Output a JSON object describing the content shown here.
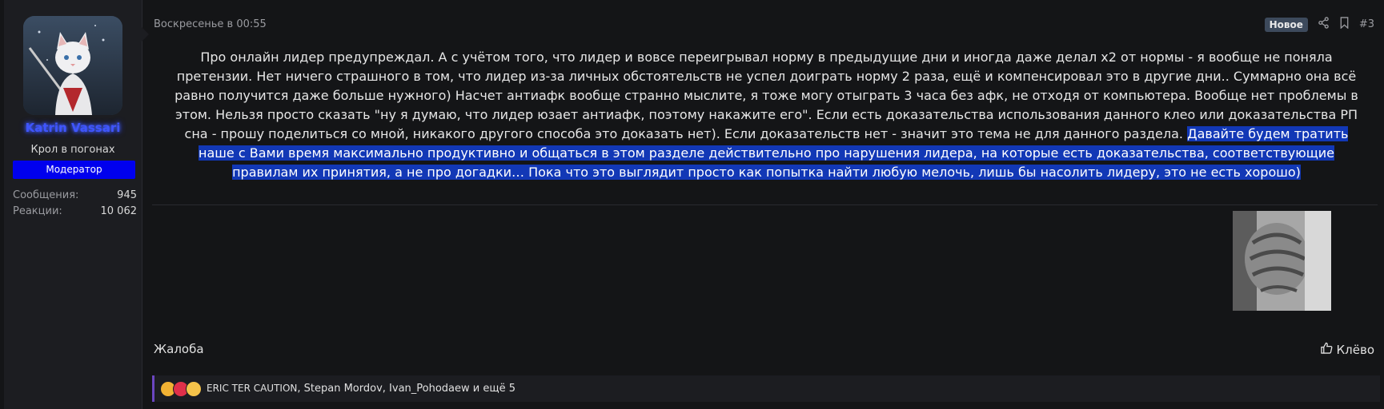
{
  "user": {
    "name": "Katrin Vassari",
    "title": "Крол в погонах",
    "role": "Модератор",
    "stats": [
      {
        "label": "Сообщения:",
        "value": "945"
      },
      {
        "label": "Реакции:",
        "value": "10 062"
      }
    ]
  },
  "post": {
    "date": "Воскресенье в 00:55",
    "badge": "Новое",
    "number": "#3",
    "lines": [
      {
        "text": "Про онлайн лидер предупреждал. А с учётом того, что лидер и вовсе переигрывал норму в предыдущие дни и иногда даже делал x2 от нормы - я вообще не поняла",
        "hl": ""
      },
      {
        "text": "претензии. Нет ничего страшного в том, что лидер из-за личных обстоятельств не успел доиграть норму 2 раза, ещё и компенсировал это в другие дни.. Суммарно она всё",
        "hl": ""
      },
      {
        "text": "равно получится даже больше нужного) Насчет антиафк вообще странно мыслите, я тоже могу отыграть 3 часа без афк, не отходя от компьютера. Вообще нет проблемы в",
        "hl": ""
      },
      {
        "text": "этом. Нельзя просто сказать \"ну я думаю, что лидер юзает антиафк, поэтому накажите его\". Если есть доказательства использования данного клео или доказательства РП",
        "hl": ""
      },
      {
        "text": "сна - прошу поделиться со мной, никакого другого способа это доказать нет). Если доказательств нет - значит это тема не для данного раздела.",
        "hl": "Давайте будем тратить"
      },
      {
        "text": "",
        "hl": "наше с Вами время максимально продуктивно и общаться в этом разделе действительно про нарушения лидера, на которые есть доказательства, соответствующие"
      },
      {
        "text": "",
        "hl": "правилам их принятия, а не про догадки… Пока что это выглядит просто как попытка найти любую мелочь, лишь бы насолить лидеру, это не есть хорошо)"
      }
    ],
    "report_label": "Жалоба",
    "like_label": "Клёво"
  },
  "reactions": {
    "emoji_icons": [
      "thumbs-up-icon",
      "heart-icon",
      "laughing-icon"
    ],
    "first_name": "ERIC TER CAUTION",
    "rest": ", Stepan Mordov, Ivan_Pohodaew и ещё 5"
  },
  "colors": {
    "username": "#3f55ff",
    "role_badge": "#0000ee",
    "highlight": "#1238b6",
    "reaction_bar_accent": "#6b46c1"
  }
}
